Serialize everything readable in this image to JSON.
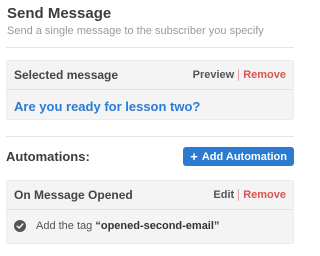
{
  "header": {
    "title": "Send Message",
    "subtitle": "Send a single message to the subscriber you specify"
  },
  "selected_message": {
    "label": "Selected message",
    "preview_label": "Preview",
    "remove_label": "Remove",
    "message_name": "Are you ready for lesson two?"
  },
  "automations": {
    "label": "Automations:",
    "add_button_label": "Add Automation",
    "trigger": {
      "label": "On Message Opened",
      "edit_label": "Edit",
      "remove_label": "Remove",
      "action_prefix": "Add the tag",
      "tag_name": "“opened-second-email”"
    }
  },
  "colors": {
    "accent": "#2b7bd3",
    "danger": "#d9534f"
  },
  "icons": {
    "add": "plus-icon",
    "check": "check-circle-icon"
  }
}
